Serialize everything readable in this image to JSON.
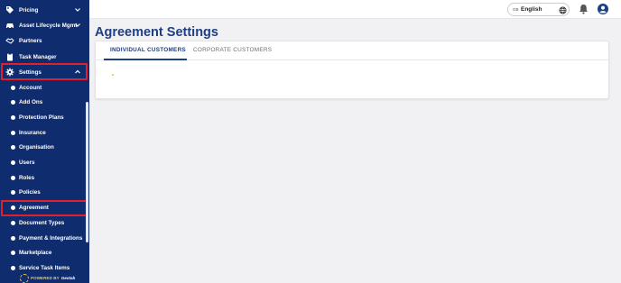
{
  "sidebar": {
    "items": {
      "pricing": {
        "label": "Pricing",
        "icon": "tag-icon"
      },
      "asset": {
        "label": "Asset Lifecycle Mgmt",
        "icon": "car-icon"
      },
      "partners": {
        "label": "Partners",
        "icon": "handshake-icon"
      },
      "task_manager": {
        "label": "Task Manager",
        "icon": "clipboard-icon"
      },
      "settings": {
        "label": "Settings",
        "icon": "gear-icon"
      }
    },
    "settings_submenu": [
      "Account",
      "Add Ons",
      "Protection Plans",
      "Insurance",
      "Organisation",
      "Users",
      "Roles",
      "Policies",
      "Agreement",
      "Document Types",
      "Payment & Integrations",
      "Marketplace",
      "Service Task Items"
    ],
    "powered_by": "POWERED BY",
    "brand": "Geotab"
  },
  "topbar": {
    "language_code": "GB",
    "language_name": "English",
    "globe_icon": "globe-icon",
    "bell_icon": "bell-icon",
    "user_icon": "user-circle-icon"
  },
  "page": {
    "title": "Agreement Settings",
    "tabs": [
      "INDIVIDUAL CUSTOMERS",
      "CORPORATE CUSTOMERS"
    ],
    "active_tab": "INDIVIDUAL CUSTOMERS"
  },
  "colors": {
    "sidebar_bg": "#0f2c6e",
    "accent": "#1d3f84",
    "highlight": "#e0202c"
  }
}
